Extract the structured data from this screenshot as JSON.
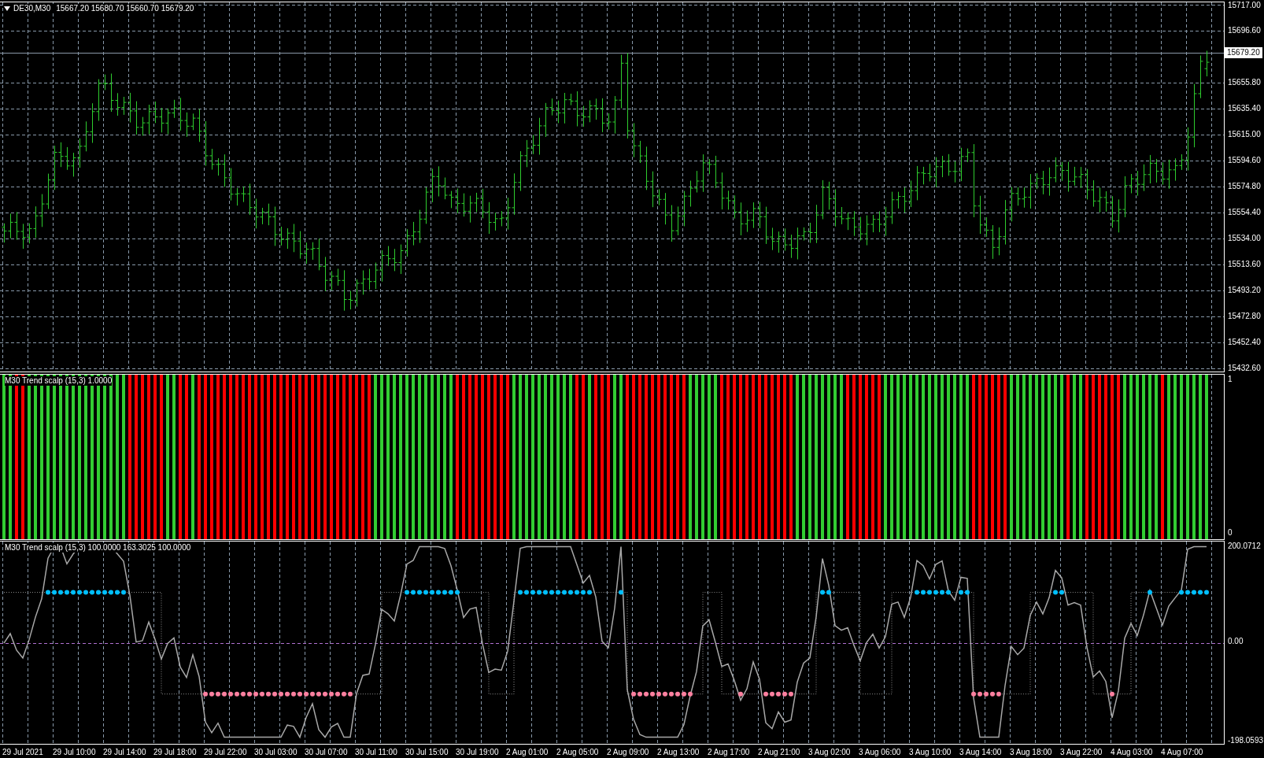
{
  "chart": {
    "symbol": "DE30,M30",
    "ohlc": [
      "15667.20",
      "15680.70",
      "15660.70",
      "15679.20"
    ],
    "price_axis": [
      "15717.00",
      "15696.60",
      "15655.80",
      "15635.40",
      "15615.00",
      "15594.60",
      "15574.80",
      "15554.40",
      "15534.00",
      "15513.60",
      "15493.20",
      "15472.80",
      "15452.40",
      "15432.60"
    ],
    "current_price": "15679.20"
  },
  "histogram_pane": {
    "label": "M30 Trend scalp (15,3) 1.0000",
    "axis": [
      "1",
      "0"
    ]
  },
  "oscillator_pane": {
    "label": "M30 Trend scalp (15,3) 100.0000 163.3025 100.0000",
    "axis": [
      "200.0712",
      "0.00",
      "-198.0593"
    ]
  },
  "time_axis": [
    "29 Jul 2021",
    "29 Jul 10:00",
    "29 Jul 14:00",
    "29 Jul 18:00",
    "29 Jul 22:00",
    "30 Jul 03:00",
    "30 Jul 07:00",
    "30 Jul 11:00",
    "30 Jul 15:00",
    "30 Jul 19:00",
    "2 Aug 01:00",
    "2 Aug 05:00",
    "2 Aug 09:00",
    "2 Aug 13:00",
    "2 Aug 17:00",
    "2 Aug 21:00",
    "3 Aug 02:00",
    "3 Aug 06:00",
    "3 Aug 10:00",
    "3 Aug 14:00",
    "3 Aug 18:00",
    "3 Aug 22:00",
    "4 Aug 03:00",
    "4 Aug 07:00"
  ]
}
